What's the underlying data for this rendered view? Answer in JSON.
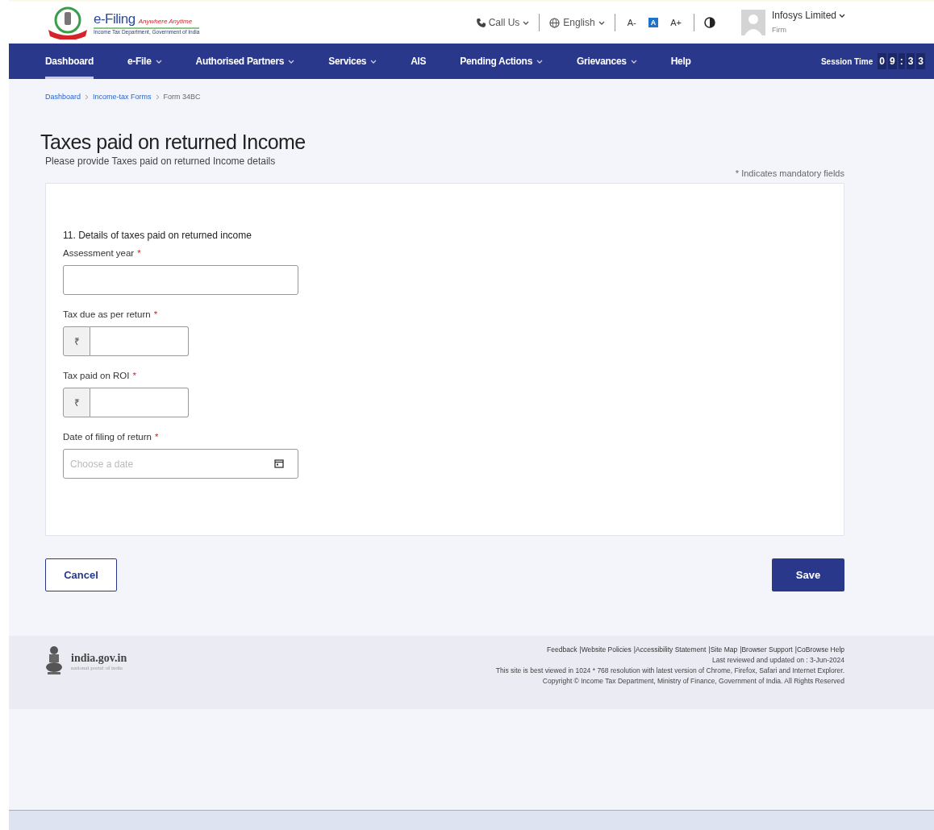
{
  "header": {
    "brand": "e-Filing",
    "tagline": "Anywhere Anytime",
    "department": "Income Tax Department, Government of India",
    "call_us": "Call Us",
    "language": "English",
    "font_controls": [
      {
        "label": "A-",
        "selected": false
      },
      {
        "label": "A",
        "selected": true
      },
      {
        "label": "A+",
        "selected": false
      }
    ],
    "user": {
      "name": "Infosys Limited",
      "role": "Firm"
    }
  },
  "nav": {
    "items": [
      {
        "label": "Dashboard",
        "selected": true,
        "dropdown": false
      },
      {
        "label": "e-File",
        "selected": false,
        "dropdown": true
      },
      {
        "label": "Authorised Partners",
        "selected": false,
        "dropdown": true
      },
      {
        "label": "Services",
        "selected": false,
        "dropdown": true
      },
      {
        "label": "AIS",
        "selected": false,
        "dropdown": false
      },
      {
        "label": "Pending Actions",
        "selected": false,
        "dropdown": true
      },
      {
        "label": "Grievances",
        "selected": false,
        "dropdown": true
      },
      {
        "label": "Help",
        "selected": false,
        "dropdown": false
      }
    ],
    "session_label": "Session Time",
    "session_digits": [
      "0",
      "9",
      ":",
      "3",
      "3"
    ]
  },
  "breadcrumb": [
    {
      "label": "Dashboard",
      "link": true
    },
    {
      "label": "Income-tax Forms",
      "link": true
    },
    {
      "label": "Form 34BC",
      "link": false
    }
  ],
  "page": {
    "title": "Taxes paid on returned Income",
    "subtitle": "Please provide Taxes paid on returned Income details",
    "mandatory_note": "* Indicates mandatory fields"
  },
  "form": {
    "section": "11. Details of taxes paid on returned income",
    "fields": [
      {
        "kind": "text",
        "label": "Assessment year",
        "required_mark": "*"
      },
      {
        "kind": "currency",
        "label": "Tax due as per return",
        "required_mark": "*",
        "prefix": "₹"
      },
      {
        "kind": "currency",
        "label": "Tax paid on ROI",
        "required_mark": "*",
        "prefix": "₹"
      },
      {
        "kind": "date",
        "label": "Date of filing of return",
        "required_mark": "*",
        "placeholder": "Choose a date"
      }
    ]
  },
  "actions": {
    "cancel": "Cancel",
    "save": "Save"
  },
  "footer": {
    "portal": "india.gov.in",
    "portal_sub": "national portal of india",
    "links": [
      "Feedback",
      "|Website Policies",
      "|Accessibility Statement",
      "|Site Map",
      "|Browser Support",
      "|CoBrowse Help"
    ],
    "updated": "Last reviewed and updated on : 3-Jun-2024",
    "best_viewed": "This site is best viewed in 1024 * 768 resolution with latest version of Chrome, Firefox, Safari and Internet Explorer.",
    "copyright": "Income Tax Department, Ministry of Finance, Government of India. All Rights Reserved",
    "copyright_prefix": "Copyright ©"
  }
}
